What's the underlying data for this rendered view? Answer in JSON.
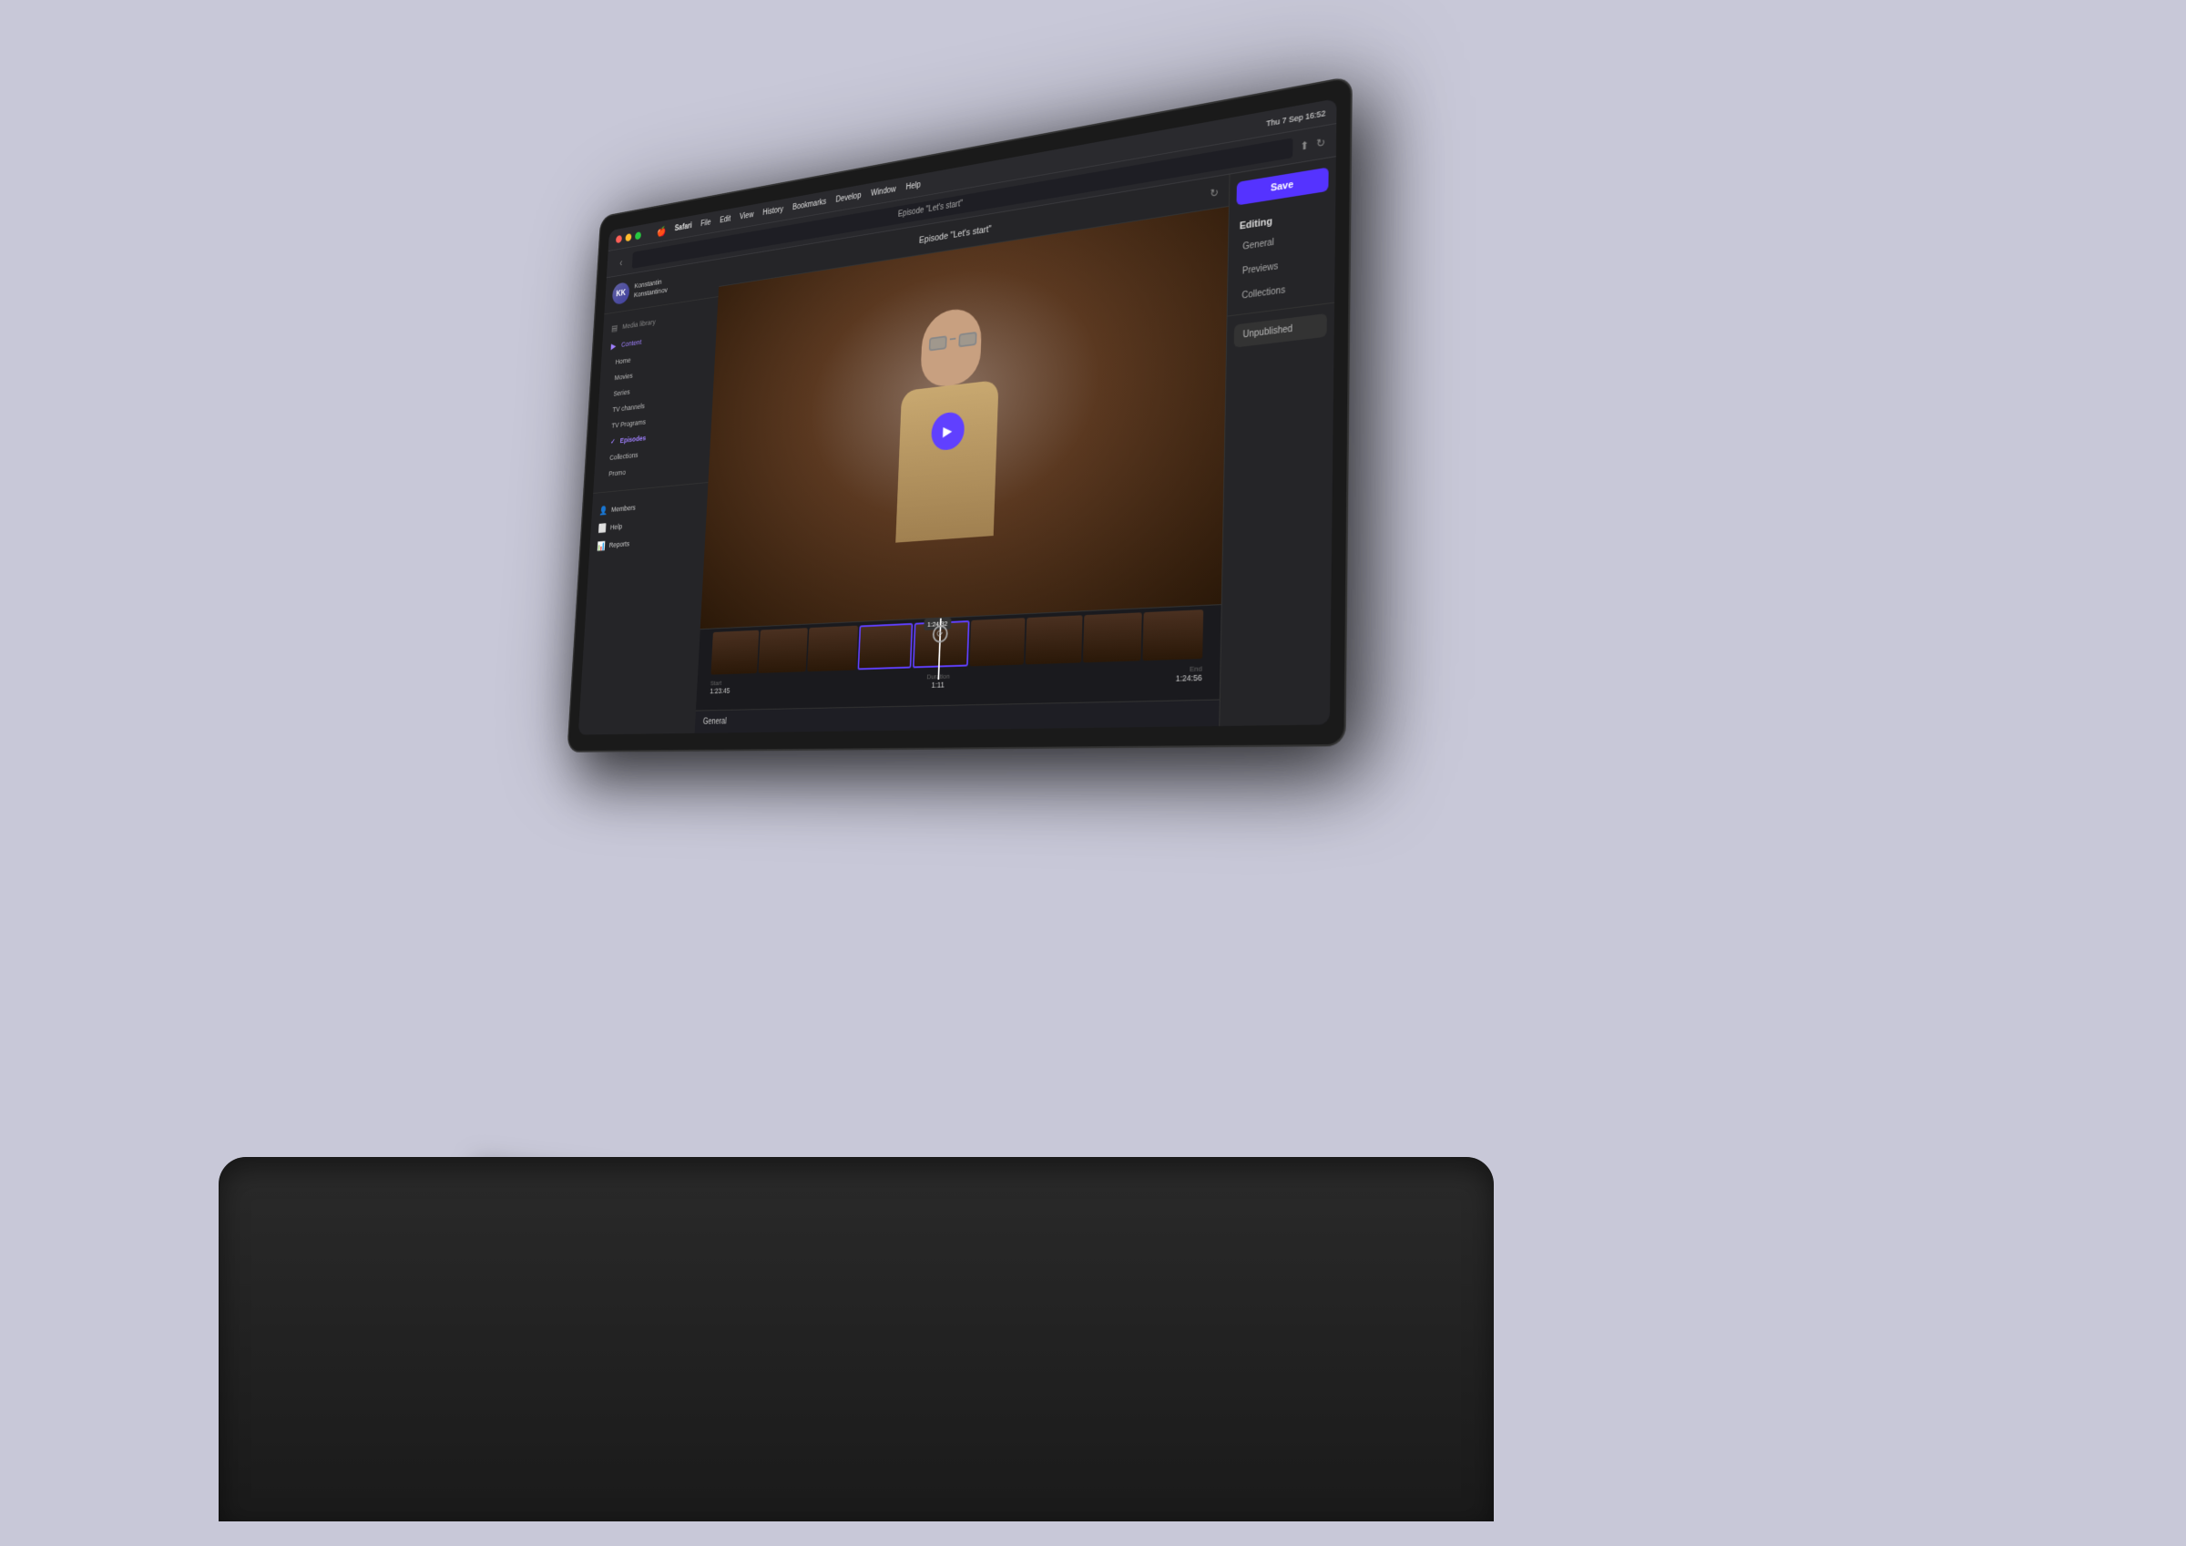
{
  "macos": {
    "menu_items": [
      "🍎",
      "Safari",
      "File",
      "Edit",
      "View",
      "History",
      "Bookmarks",
      "Develop",
      "Window",
      "Help"
    ],
    "right_status": "Thu 7 Sep  16:52"
  },
  "browser": {
    "back_button": "‹",
    "title": "Episode \"Let's start\""
  },
  "sidebar": {
    "user": {
      "name_line1": "Konstantin",
      "name_line2": "Konstantinov",
      "initials": "KK"
    },
    "sections": [
      {
        "label": "Media library",
        "icon": "▤"
      }
    ],
    "content_label": "Content",
    "nav_items": [
      {
        "label": "Home",
        "level": 2
      },
      {
        "label": "Movies",
        "level": 2
      },
      {
        "label": "Series",
        "level": 2
      },
      {
        "label": "TV channels",
        "level": 2
      },
      {
        "label": "TV Programs",
        "level": 2
      },
      {
        "label": "Episodes",
        "level": 2,
        "active": true,
        "checked": true
      },
      {
        "label": "Collections",
        "level": 2
      },
      {
        "label": "Promo",
        "level": 2
      }
    ],
    "bottom_items": [
      {
        "label": "Members",
        "icon": "👤"
      },
      {
        "label": "Help",
        "icon": "⬜"
      },
      {
        "label": "Reports",
        "icon": "📊"
      }
    ]
  },
  "content": {
    "title": "Episode \"Let's start\"",
    "save_button": "Save"
  },
  "right_panel": {
    "editing_label": "Editing",
    "menu_items": [
      {
        "label": "General"
      },
      {
        "label": "Previews"
      },
      {
        "label": "Collections"
      }
    ],
    "unpublished_label": "Unpublished",
    "general_label": "General"
  },
  "timeline": {
    "current_time": "1:24:32",
    "start_label": "Start",
    "start_value": "1:23:45",
    "duration_label": "Duration",
    "duration_value": "1:11",
    "end_label": "End",
    "end_value": "1:24:56"
  }
}
